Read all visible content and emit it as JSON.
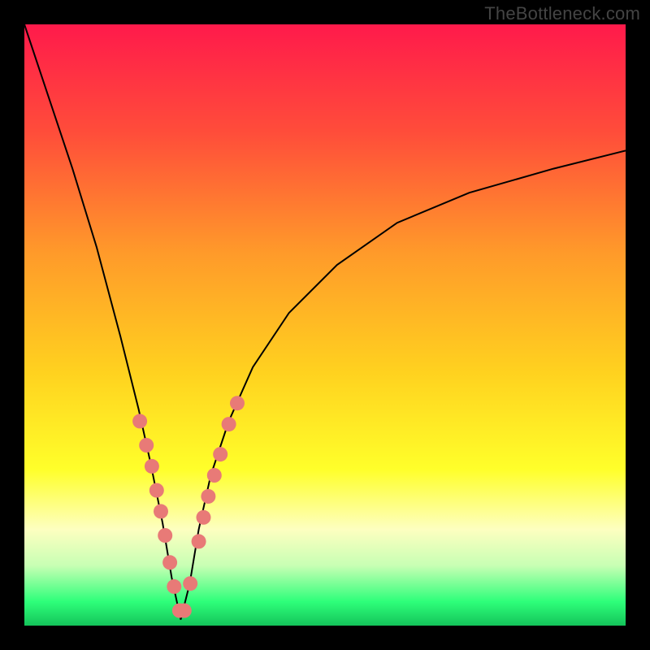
{
  "watermark": "TheBottleneck.com",
  "colors": {
    "frame": "#000000",
    "curve": "#000000",
    "dot": "#e87a77",
    "gradient_stops": [
      {
        "pct": 0,
        "color": "#ff1a4b"
      },
      {
        "pct": 18,
        "color": "#ff4d3a"
      },
      {
        "pct": 38,
        "color": "#ff9a2a"
      },
      {
        "pct": 58,
        "color": "#ffd21f"
      },
      {
        "pct": 74,
        "color": "#ffff2a"
      },
      {
        "pct": 84,
        "color": "#fdffc0"
      },
      {
        "pct": 90,
        "color": "#c8ffb4"
      },
      {
        "pct": 96,
        "color": "#2eff7a"
      },
      {
        "pct": 100,
        "color": "#14c45a"
      }
    ]
  },
  "chart_data": {
    "type": "line",
    "title": "",
    "xlabel": "",
    "ylabel": "",
    "xlim": [
      0,
      100
    ],
    "ylim": [
      0,
      100
    ],
    "note": "V-shaped bottleneck curve. x is horizontal position (0–100,left→right), y is percent value (0 bottom, 100 top of plot). Minimum (touching the green band) occurs near x≈26. Pink dots mark sample points on both arms of the curve in the lower yellow/green region.",
    "series": [
      {
        "name": "bottleneck-curve",
        "x": [
          0,
          4,
          8,
          12,
          16,
          19,
          21,
          23,
          24.5,
          26,
          27.5,
          29,
          31,
          34,
          38,
          44,
          52,
          62,
          74,
          88,
          100
        ],
        "y": [
          100,
          88,
          76,
          63,
          48,
          36,
          27,
          17,
          8,
          1,
          7,
          16,
          25,
          34,
          43,
          52,
          60,
          67,
          72,
          76,
          79
        ]
      }
    ],
    "dots": {
      "name": "sample-points",
      "x": [
        19.2,
        20.3,
        21.2,
        22.0,
        22.7,
        23.4,
        24.2,
        24.9,
        25.8,
        26.6,
        27.6,
        29.0,
        29.8,
        30.6,
        31.6,
        32.6,
        34.0,
        35.4
      ],
      "y": [
        34,
        30,
        26.5,
        22.5,
        19,
        15,
        10.5,
        6.5,
        2.5,
        2.5,
        7,
        14,
        18,
        21.5,
        25,
        28.5,
        33.5,
        37
      ]
    }
  }
}
